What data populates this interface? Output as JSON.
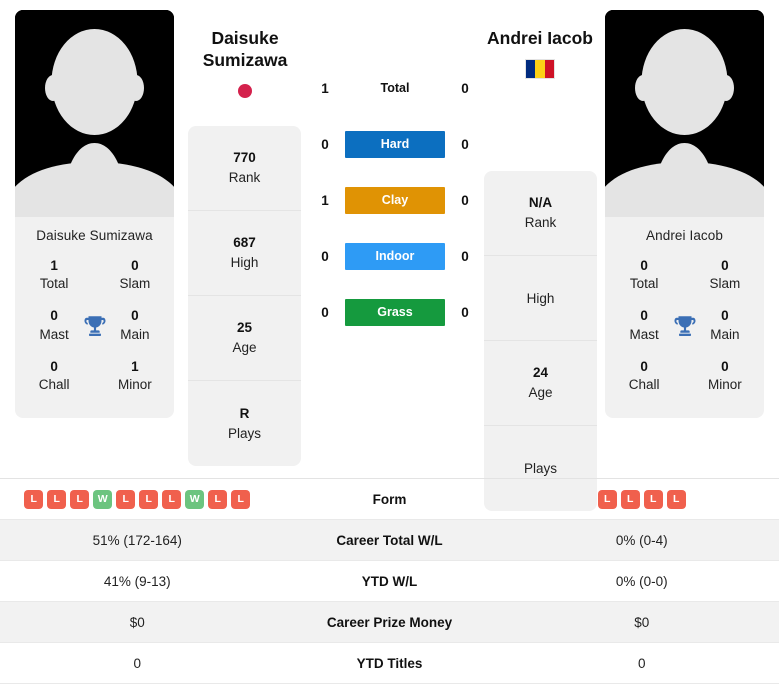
{
  "players": {
    "left": {
      "name": "Daisuke Sumizawa",
      "display_name_line1": "Daisuke",
      "display_name_line2": "Sumizawa",
      "flag": "japan-flag",
      "avatar": "player-photo-placeholder",
      "titles": {
        "total_value": "1",
        "total_label": "Total",
        "slam_value": "0",
        "slam_label": "Slam",
        "mast_value": "0",
        "mast_label": "Mast",
        "main_value": "0",
        "main_label": "Main",
        "chall_value": "0",
        "chall_label": "Chall",
        "minor_value": "1",
        "minor_label": "Minor"
      },
      "ranks": [
        {
          "value": "770",
          "label": "Rank"
        },
        {
          "value": "687",
          "label": "High"
        },
        {
          "value": "25",
          "label": "Age"
        },
        {
          "value": "R",
          "label": "Plays"
        }
      ],
      "surface_wins": {
        "total": "1",
        "hard": "0",
        "clay": "1",
        "indoor": "0",
        "grass": "0"
      },
      "form": [
        "L",
        "L",
        "L",
        "W",
        "L",
        "L",
        "L",
        "W",
        "L",
        "L"
      ],
      "career_total_wl": "51% (172-164)",
      "ytd_wl": "41% (9-13)",
      "career_prize_money": "$0",
      "ytd_titles": "0"
    },
    "right": {
      "name": "Andrei Iacob",
      "display_name_line1": "Andrei Iacob",
      "display_name_line2": "",
      "flag": "romania-flag",
      "avatar": "player-photo-placeholder",
      "titles": {
        "total_value": "0",
        "total_label": "Total",
        "slam_value": "0",
        "slam_label": "Slam",
        "mast_value": "0",
        "mast_label": "Mast",
        "main_value": "0",
        "main_label": "Main",
        "chall_value": "0",
        "chall_label": "Chall",
        "minor_value": "0",
        "minor_label": "Minor"
      },
      "ranks": [
        {
          "value": "N/A",
          "label": "Rank"
        },
        {
          "value": "",
          "label": "High"
        },
        {
          "value": "24",
          "label": "Age"
        },
        {
          "value": "",
          "label": "Plays"
        }
      ],
      "surface_wins": {
        "total": "0",
        "hard": "0",
        "clay": "0",
        "indoor": "0",
        "grass": "0"
      },
      "form": [
        "L",
        "L",
        "L",
        "L"
      ],
      "career_total_wl": "0% (0-4)",
      "ytd_wl": "0% (0-0)",
      "career_prize_money": "$0",
      "ytd_titles": "0"
    }
  },
  "surfaces": [
    {
      "key": "total",
      "label": "Total",
      "color": ""
    },
    {
      "key": "hard",
      "label": "Hard",
      "color": "#0c6fc0"
    },
    {
      "key": "clay",
      "label": "Clay",
      "color": "#e09304"
    },
    {
      "key": "indoor",
      "label": "Indoor",
      "color": "#2e9bf5"
    },
    {
      "key": "grass",
      "label": "Grass",
      "color": "#159a3e"
    }
  ],
  "table_labels": {
    "form": "Form",
    "career_total_wl": "Career Total W/L",
    "ytd_wl": "YTD W/L",
    "career_prize_money": "Career Prize Money",
    "ytd_titles": "YTD Titles"
  },
  "colors": {
    "win_badge": "#6cc47f",
    "loss_badge": "#f0604d",
    "trophy": "#3b6fb5",
    "card_bg": "#f1f1f1",
    "row_shaded": "#f2f2f2"
  }
}
